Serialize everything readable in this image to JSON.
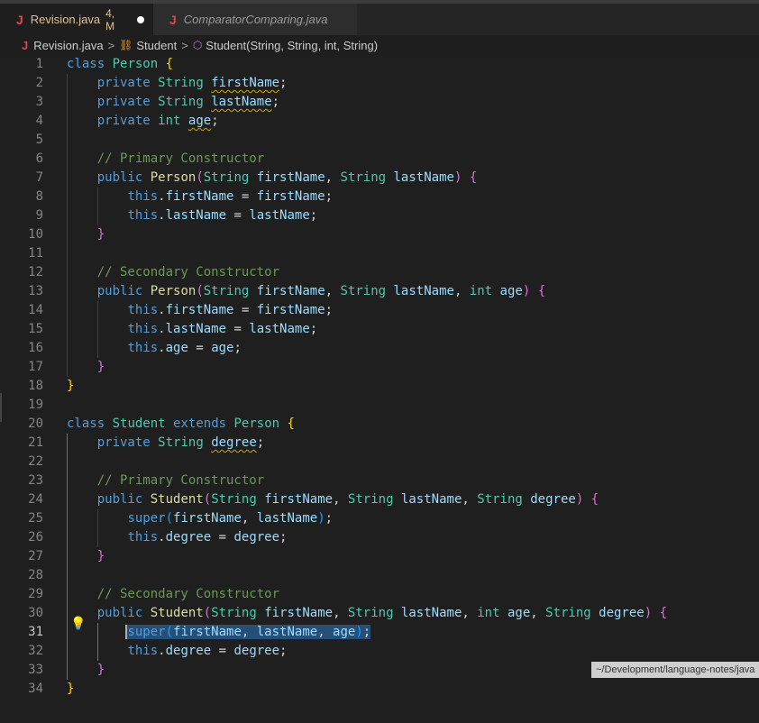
{
  "tabs": [
    {
      "label": "Revision.java",
      "badge": "4, M",
      "icon": "java-file-icon",
      "modified": true,
      "active": true
    },
    {
      "label": "ComparatorComparing.java",
      "icon": "java-file-icon",
      "active": false
    }
  ],
  "breadcrumb": {
    "file": "Revision.java",
    "class": "Student",
    "method": "Student(String, String, int, String)",
    "separator": ">",
    "java_icon": "J",
    "class_icon": "⛓",
    "method_icon": "⬡"
  },
  "editor": {
    "current_line": 31,
    "line_numbers": [
      "1",
      "2",
      "3",
      "4",
      "5",
      "6",
      "7",
      "8",
      "9",
      "10",
      "11",
      "12",
      "13",
      "14",
      "15",
      "16",
      "17",
      "18",
      "19",
      "20",
      "21",
      "22",
      "23",
      "24",
      "25",
      "26",
      "27",
      "28",
      "29",
      "30",
      "31",
      "32",
      "33",
      "34"
    ],
    "lightbulb_line": 31,
    "lightbulb_icon": "💡"
  },
  "tooltip": "~/Development/language-notes/java",
  "colors": {
    "keyword": "#569cd6",
    "type": "#4ec9b0",
    "function": "#dcdcaa",
    "variable": "#9cdcfe",
    "comment": "#6a9955",
    "selection": "#264f78",
    "warning_squiggle": "#cca700",
    "tab_modified": "#e2c08d",
    "java_icon": "#e0444e"
  },
  "tokens": {
    "class": "class",
    "extends": "extends",
    "private": "private",
    "public": "public",
    "this": "this",
    "super": "super",
    "int": "int",
    "String": "String",
    "Person": "Person",
    "Student": "Student",
    "firstName": "firstName",
    "lastName": "lastName",
    "age": "age",
    "degree": "degree",
    "c_primary": "// Primary Constructor",
    "c_secondary": "// Secondary Constructor",
    "lbrace": "{",
    "rbrace": "}",
    "lparen": "(",
    "rparen": ")",
    "semi": ";",
    "comma": ", ",
    "dot": ".",
    "eq": " = ",
    "sp": " "
  }
}
